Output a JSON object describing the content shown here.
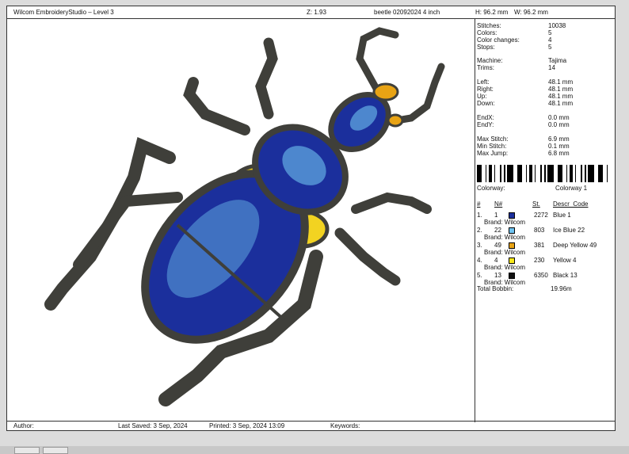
{
  "header": {
    "title": "Wilcom EmbroideryStudio – Level 3",
    "zoom": "Z: 1.93",
    "filename": "beetle 02092024 4 inch",
    "height": "H: 96.2 mm",
    "width": "W: 96.2 mm"
  },
  "stats": [
    {
      "label": "Stitches:",
      "value": "10038"
    },
    {
      "label": "Colors:",
      "value": "5"
    },
    {
      "label": "Color changes:",
      "value": "4"
    },
    {
      "label": "Stops:",
      "value": "5"
    },
    {
      "label": "Machine:",
      "value": "Tajima"
    },
    {
      "label": "Trims:",
      "value": "14"
    },
    {
      "label": "Left:",
      "value": "48.1 mm"
    },
    {
      "label": "Right:",
      "value": "48.1 mm"
    },
    {
      "label": "Up:",
      "value": "48.1 mm"
    },
    {
      "label": "Down:",
      "value": "48.1 mm"
    },
    {
      "label": "EndX:",
      "value": "0.0 mm"
    },
    {
      "label": "EndY:",
      "value": "0.0 mm"
    },
    {
      "label": "Max Stitch:",
      "value": "6.9 mm"
    },
    {
      "label": "Min Stitch:",
      "value": "0.1 mm"
    },
    {
      "label": "Max Jump:",
      "value": "6.8 mm"
    }
  ],
  "colorway": {
    "label": "Colorway:",
    "value": "Colorway 1"
  },
  "color_table": {
    "headers": {
      "num": "#",
      "n": "N#",
      "st": "St.",
      "descr": "Descr_Code"
    },
    "rows": [
      {
        "idx": "1.",
        "n": "1",
        "color": "#1b2f9c",
        "stitches": "2272",
        "descr": "Blue 1",
        "brand": "Brand: Wilcom"
      },
      {
        "idx": "2.",
        "n": "22",
        "color": "#6fc3f0",
        "stitches": "803",
        "descr": "Ice Blue 22",
        "brand": "Brand: Wilcom"
      },
      {
        "idx": "3.",
        "n": "49",
        "color": "#e8a314",
        "stitches": "381",
        "descr": "Deep Yellow 49",
        "brand": "Brand: Wilcom"
      },
      {
        "idx": "4.",
        "n": "4",
        "color": "#f7e81a",
        "stitches": "230",
        "descr": "Yellow 4",
        "brand": "Brand: Wilcom"
      },
      {
        "idx": "5.",
        "n": "13",
        "color": "#111111",
        "stitches": "6350",
        "descr": "Black 13",
        "brand": "Brand: Wilcom"
      }
    ],
    "total_label": "Total Bobbin:",
    "total_value": "19.96m"
  },
  "footer": {
    "author": "Author:",
    "last_saved": "Last Saved:   3 Sep, 2024",
    "printed": "Printed:   3 Sep, 2024 13:09",
    "keywords": "Keywords:"
  },
  "colors": {
    "body_dark": "#3f3f3a",
    "blue": "#1b2f9c",
    "ice_blue": "#6fc3f0",
    "deep_yellow": "#e8a314",
    "yellow": "#f7e81a"
  }
}
